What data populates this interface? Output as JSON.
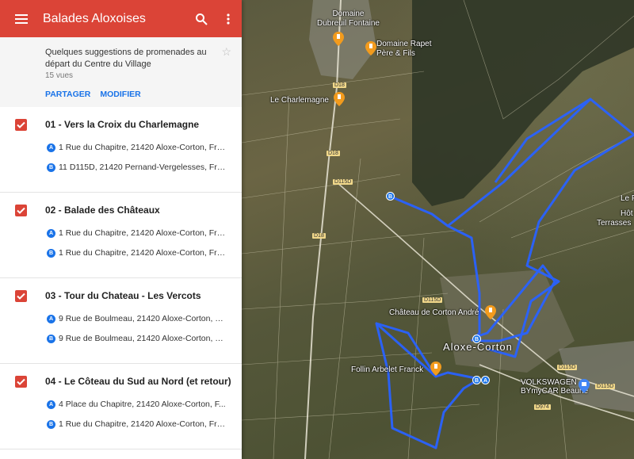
{
  "header": {
    "title": "Balades Aloxoises",
    "menu_icon": "menu-icon",
    "search_icon": "search-icon",
    "more_icon": "more-vert-icon",
    "color": "#db4437"
  },
  "description": {
    "text": "Quelques suggestions de promenades au départ du Centre du Village",
    "views": "15 vues",
    "share_label": "PARTAGER",
    "edit_label": "MODIFIER"
  },
  "routes": [
    {
      "title": "01 - Vers la Croix du Charlemagne",
      "stops": [
        {
          "letter": "A",
          "address": "1 Rue du Chapitre, 21420 Aloxe-Corton, Fra..."
        },
        {
          "letter": "B",
          "address": "11 D115D, 21420 Pernand-Vergelesses, Fra..."
        }
      ]
    },
    {
      "title": "02 - Balade des Châteaux",
      "stops": [
        {
          "letter": "A",
          "address": "1 Rue du Chapitre, 21420 Aloxe-Corton, Fra..."
        },
        {
          "letter": "B",
          "address": "1 Rue du Chapitre, 21420 Aloxe-Corton, Fra..."
        }
      ]
    },
    {
      "title": "03 - Tour du Chateau - Les Vercots",
      "stops": [
        {
          "letter": "A",
          "address": "9 Rue de Boulmeau, 21420 Aloxe-Corton, Fr..."
        },
        {
          "letter": "B",
          "address": "9 Rue de Boulmeau, 21420 Aloxe-Corton, Fr..."
        }
      ]
    },
    {
      "title": "04 - Le Côteau du Sud au Nord (et retour)",
      "stops": [
        {
          "letter": "A",
          "address": "4 Place du Chapitre, 21420 Aloxe-Corton, F..."
        },
        {
          "letter": "B",
          "address": "1 Rue du Chapitre, 21420 Aloxe-Corton, Fra..."
        }
      ]
    }
  ],
  "map": {
    "places": {
      "domaine_dubreuil": "Domaine\nDubreuil Fontaine",
      "domaine_rapet": "Domaine Rapet\nPère & Fils",
      "charlemagne": "Le Charlemagne",
      "chateau_corton": "Château de Corton André",
      "village": "Aloxe-Corton",
      "follin": "Follin Arbelet Franck",
      "vw": "VOLKSWAGEN\nBYmyCAR Beaune",
      "le_f": "Le F",
      "hot": "Hôt",
      "terrasses": "Terrasses"
    },
    "roads": [
      "D18",
      "D18",
      "D115D",
      "D18",
      "D115D",
      "D115D",
      "D115D",
      "D974"
    ],
    "route_color": "#2962ff",
    "markers": [
      "B",
      "B",
      "B",
      "A"
    ]
  }
}
